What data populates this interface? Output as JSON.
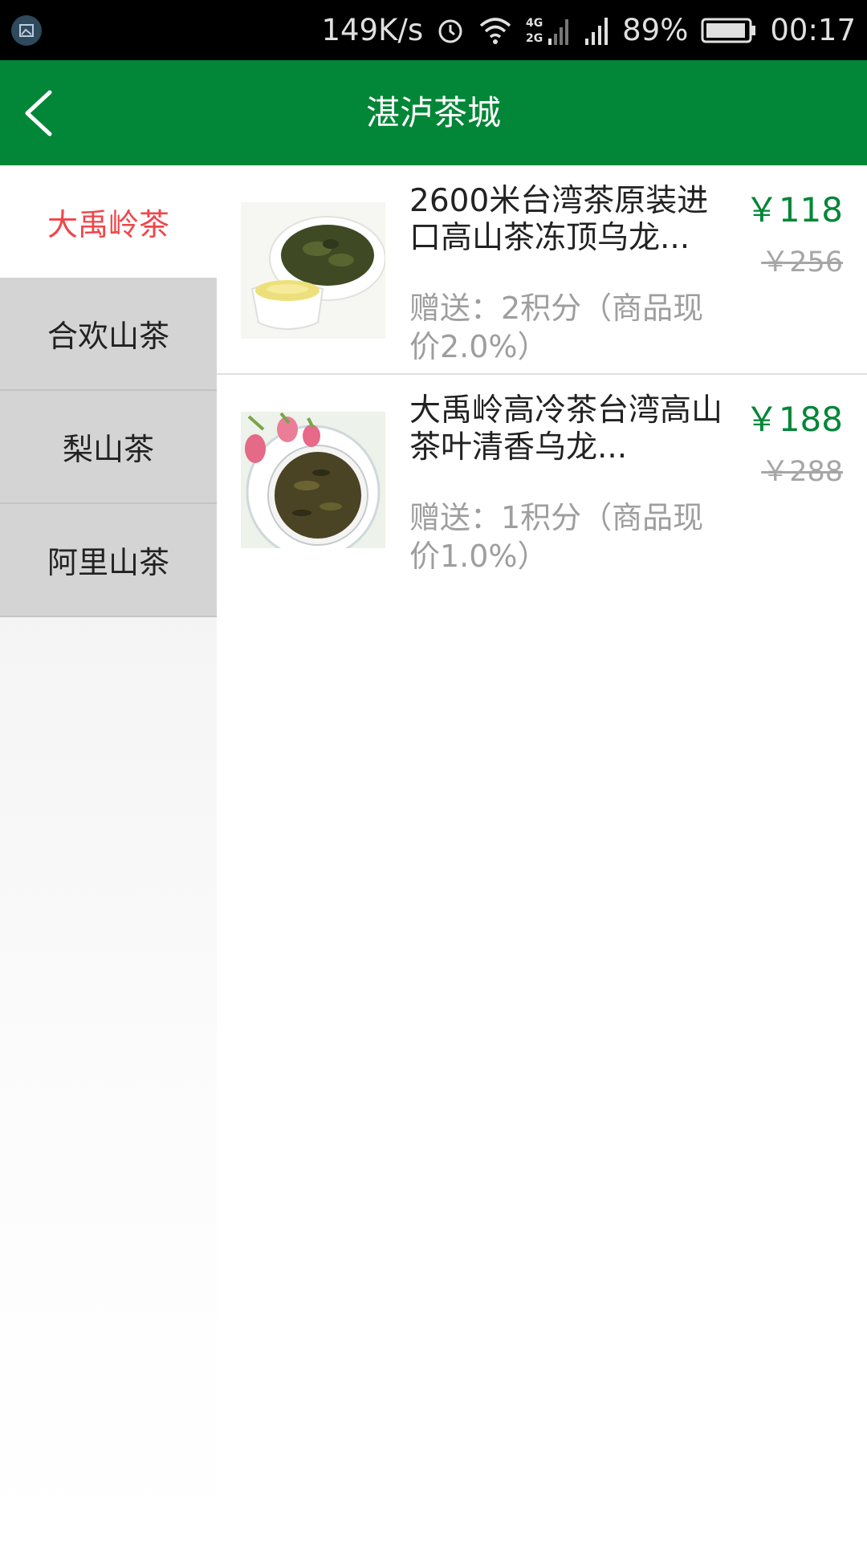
{
  "status_bar": {
    "speed": "149K/s",
    "network": "4G 2G",
    "battery": "89%",
    "time": "00:17"
  },
  "header": {
    "title": "湛泸茶城"
  },
  "categories": [
    {
      "label": "大禹岭茶",
      "active": true
    },
    {
      "label": "合欢山茶",
      "active": false
    },
    {
      "label": "梨山茶",
      "active": false
    },
    {
      "label": "阿里山茶",
      "active": false
    }
  ],
  "products": [
    {
      "name": "2600米台湾茶原装进口高山茶冻顶乌龙...",
      "gift": "赠送：2积分（商品现价2.0%）",
      "price": "￥118",
      "original_price": "￥256"
    },
    {
      "name": "大禹岭高冷茶台湾高山茶叶清香乌龙...",
      "gift": "赠送：1积分（商品现价1.0%）",
      "price": "￥188",
      "original_price": "￥288"
    }
  ],
  "colors": {
    "primary": "#028637",
    "active_category": "#f0464a"
  }
}
